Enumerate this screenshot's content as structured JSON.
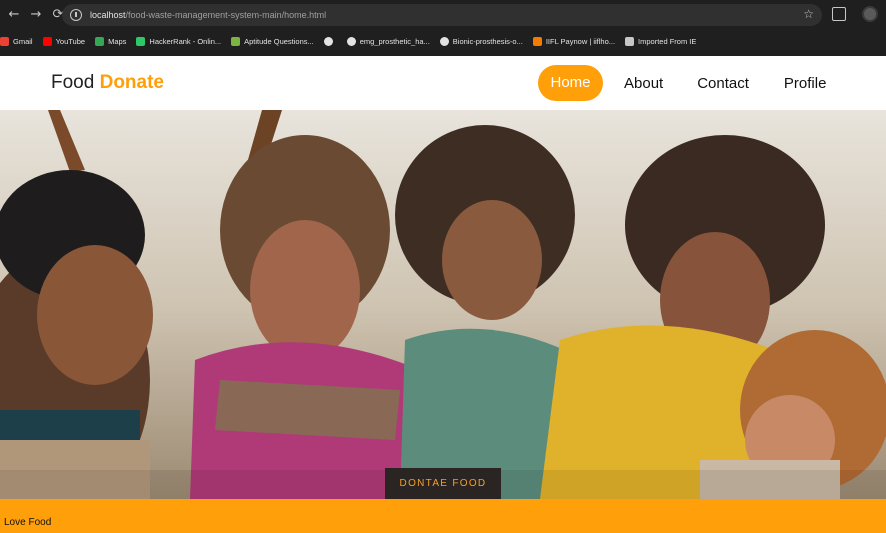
{
  "browser": {
    "url_host": "localhost",
    "url_path": "/food-waste-management-system-main/home.html",
    "bookmarks": [
      {
        "label": "Gmail",
        "icon": "gmail-icon",
        "color": "#ea4335"
      },
      {
        "label": "YouTube",
        "icon": "youtube-icon",
        "color": "#ff0000"
      },
      {
        "label": "Maps",
        "icon": "maps-icon",
        "color": "#34a853"
      },
      {
        "label": "HackerRank - Onlin...",
        "icon": "hackerrank-icon",
        "color": "#2ec866"
      },
      {
        "label": "Aptitude Questions...",
        "icon": "aptitude-icon",
        "color": "#7cb342"
      },
      {
        "label": "",
        "icon": "globe-icon",
        "color": "#e3e3e3"
      },
      {
        "label": "emg_prosthetic_ha...",
        "icon": "github-icon",
        "color": "#e3e3e3"
      },
      {
        "label": "Bionic-prosthesis-o...",
        "icon": "github-icon",
        "color": "#e3e3e3"
      },
      {
        "label": "IIFL Paynow | iiflho...",
        "icon": "iifl-icon",
        "color": "#f57c00"
      },
      {
        "label": "Imported From IE",
        "icon": "folder-icon",
        "color": "#c7c7c7"
      }
    ]
  },
  "header": {
    "logo_main": "Food",
    "logo_accent": "Donate",
    "nav": {
      "home": "Home",
      "about": "About",
      "contact": "Contact",
      "profile": "Profile"
    }
  },
  "hero": {
    "button_label": "DONTAE FOOD"
  },
  "footer": {
    "text": "Love Food"
  },
  "colors": {
    "accent": "#ff9f0a",
    "button_bg": "#2a2523",
    "button_text": "#f6a028"
  }
}
